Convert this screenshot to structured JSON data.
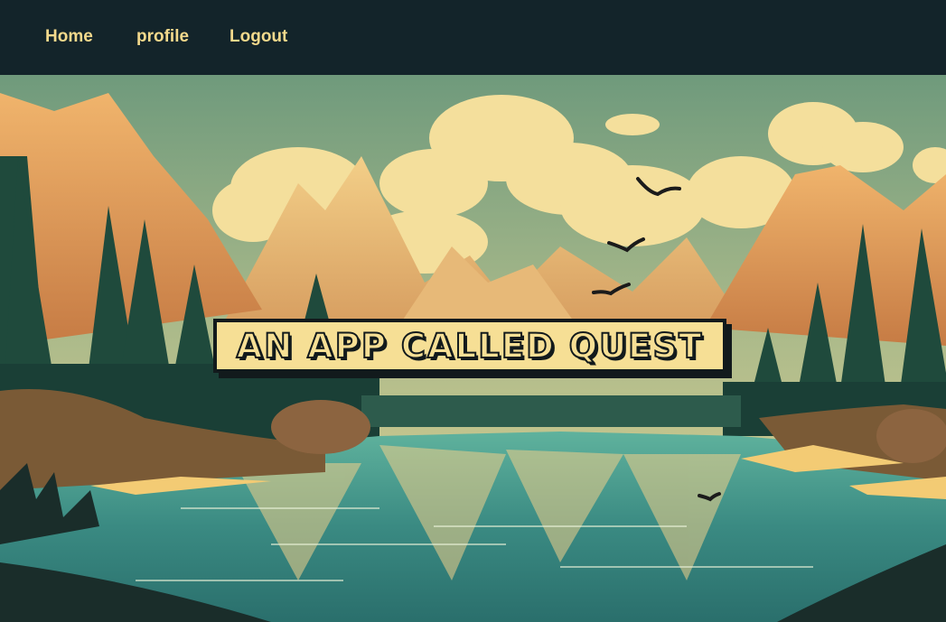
{
  "nav": {
    "links": [
      {
        "label": "Home"
      },
      {
        "label": "profile"
      },
      {
        "label": "Logout"
      }
    ]
  },
  "hero": {
    "title": "AN APP CALLED QUEST",
    "image": "illustrated-mountain-lake-landscape"
  },
  "colors": {
    "nav_bg": "#13242a",
    "nav_text": "#f3d98c",
    "title_fill": "#f6df95",
    "title_outline": "#121a1c",
    "sky": "#7fa486",
    "cloud": "#f4df9c",
    "mountain": "#e7a564",
    "forest": "#1f4a3c",
    "lake": "#3f8f86"
  }
}
